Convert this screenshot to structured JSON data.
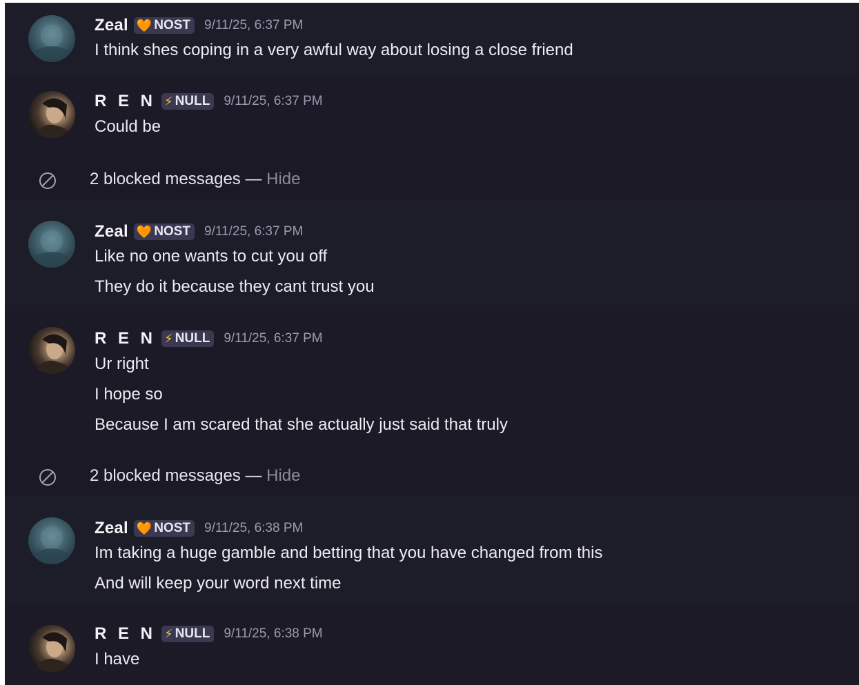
{
  "messages": [
    {
      "username": "Zeal",
      "tag": "NOST",
      "timestamp": "9/11/25, 6:37 PM",
      "lines": [
        "I think shes coping in a very awful way about losing a close friend"
      ]
    },
    {
      "username": "R E N",
      "tag": "NULL",
      "timestamp": "9/11/25, 6:37 PM",
      "lines": [
        "Could be"
      ]
    },
    {
      "username": "Zeal",
      "tag": "NOST",
      "timestamp": "9/11/25, 6:37 PM",
      "lines": [
        "Like no one wants to cut you off",
        "They do it because they cant trust you"
      ]
    },
    {
      "username": "R E N",
      "tag": "NULL",
      "timestamp": "9/11/25, 6:37 PM",
      "lines": [
        "Ur right",
        "I hope so",
        "Because I am scared that she actually just said that truly"
      ]
    },
    {
      "username": "Zeal",
      "tag": "NOST",
      "timestamp": "9/11/25, 6:38 PM",
      "lines": [
        "Im taking a huge gamble and betting that you have changed from this",
        "And will keep your word next time"
      ]
    },
    {
      "username": "R E N",
      "tag": "NULL",
      "timestamp": "9/11/25, 6:38 PM",
      "lines": [
        "I have"
      ]
    }
  ],
  "blocked": [
    {
      "text": "2 blocked messages",
      "separator": " — ",
      "action": "Hide",
      "icon": "blocked-icon"
    },
    {
      "text": "2 blocked messages",
      "separator": " — ",
      "action": "Hide",
      "icon": "blocked-icon"
    }
  ],
  "icons": {
    "zeal_tag": "rose-icon",
    "ren_tag": "lightning-icon"
  },
  "colors": {
    "background": "#1b1a26",
    "tag_bg": "#3a3951",
    "timestamp": "#9c9baf",
    "hide_link": "#8a8a9c"
  }
}
